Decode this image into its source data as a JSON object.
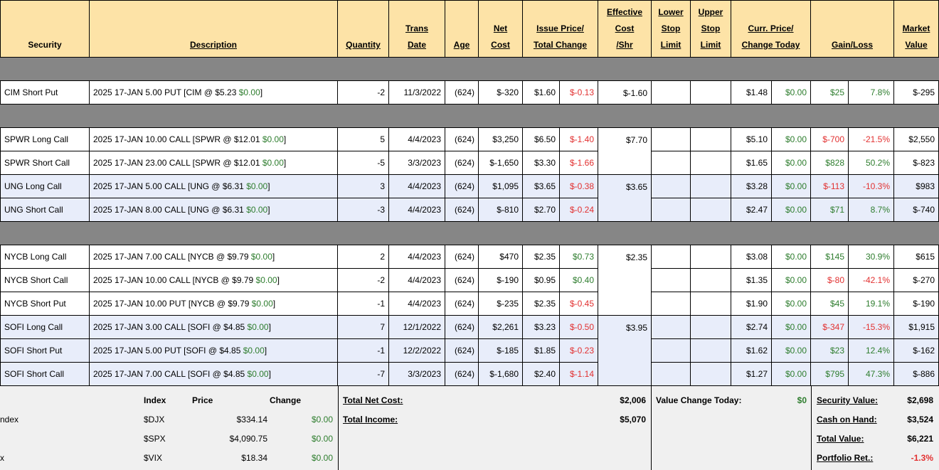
{
  "headers": [
    [
      "Security"
    ],
    [
      "Description"
    ],
    [
      "Quantity"
    ],
    [
      "Trans",
      "Date"
    ],
    [
      "Age"
    ],
    [
      "Net",
      "Cost"
    ],
    [
      "Issue Price/",
      "Total Change"
    ],
    [
      "Effective",
      "Cost",
      "/Shr"
    ],
    [
      "Lower",
      "Stop",
      "Limit"
    ],
    [
      "Upper",
      "Stop",
      "Limit"
    ],
    [
      "Curr. Price/",
      "Change Today"
    ],
    [
      "Gain/Loss"
    ],
    [
      "Market",
      "Value"
    ]
  ],
  "groups": [
    {
      "rows": [
        {
          "security": "CIM Short Put",
          "desc": "2025 17-JAN 5.00 PUT [CIM @ $5.23 ",
          "desc_change": "$0.00",
          "desc_end": "]",
          "qty": "-2",
          "date": "11/3/2022",
          "age": "(624)",
          "net": "$-320",
          "issue": "$1.60",
          "total_change": "$-0.13",
          "tc_sign": "neg",
          "curr": "$1.48",
          "change_today": "$0.00",
          "gain": "$25",
          "gain_pct": "7.8%",
          "gain_sign": "pos",
          "market": "$-295"
        }
      ],
      "eff": [
        {
          "value": "$-1.60",
          "span": 1
        }
      ]
    },
    {
      "rows": [
        {
          "security": "SPWR Long Call",
          "desc": "2025 17-JAN 10.00 CALL [SPWR @ $12.01 ",
          "desc_change": "$0.00",
          "desc_end": "]",
          "qty": "5",
          "date": "4/4/2023",
          "age": "(624)",
          "net": "$3,250",
          "issue": "$6.50",
          "total_change": "$-1.40",
          "tc_sign": "neg",
          "curr": "$5.10",
          "change_today": "$0.00",
          "gain": "$-700",
          "gain_pct": "-21.5%",
          "gain_sign": "neg",
          "market": "$2,550"
        },
        {
          "security": "SPWR Short Call",
          "desc": "2025 17-JAN 23.00 CALL [SPWR @ $12.01 ",
          "desc_change": "$0.00",
          "desc_end": "]",
          "qty": "-5",
          "date": "3/3/2023",
          "age": "(624)",
          "net": "$-1,650",
          "issue": "$3.30",
          "total_change": "$-1.66",
          "tc_sign": "neg",
          "curr": "$1.65",
          "change_today": "$0.00",
          "gain": "$828",
          "gain_pct": "50.2%",
          "gain_sign": "pos",
          "market": "$-823"
        },
        {
          "security": "UNG Long Call",
          "desc": "2025 17-JAN 5.00 CALL [UNG @ $6.31 ",
          "desc_change": "$0.00",
          "desc_end": "]",
          "qty": "3",
          "date": "4/4/2023",
          "age": "(624)",
          "net": "$1,095",
          "issue": "$3.65",
          "total_change": "$-0.38",
          "tc_sign": "neg",
          "curr": "$3.28",
          "change_today": "$0.00",
          "gain": "$-113",
          "gain_pct": "-10.3%",
          "gain_sign": "neg",
          "market": "$983",
          "blue": true
        },
        {
          "security": "UNG Short Call",
          "desc": "2025 17-JAN 8.00 CALL [UNG @ $6.31 ",
          "desc_change": "$0.00",
          "desc_end": "]",
          "qty": "-3",
          "date": "4/4/2023",
          "age": "(624)",
          "net": "$-810",
          "issue": "$2.70",
          "total_change": "$-0.24",
          "tc_sign": "neg",
          "curr": "$2.47",
          "change_today": "$0.00",
          "gain": "$71",
          "gain_pct": "8.7%",
          "gain_sign": "pos",
          "market": "$-740",
          "blue": true
        }
      ],
      "eff": [
        {
          "value": "$7.70",
          "span": 2
        },
        {
          "value": "$3.65",
          "span": 2,
          "blue": true
        }
      ]
    },
    {
      "rows": [
        {
          "security": "NYCB Long Call",
          "desc": "2025 17-JAN 7.00 CALL [NYCB @ $9.79 ",
          "desc_change": "$0.00",
          "desc_end": "]",
          "qty": "2",
          "date": "4/4/2023",
          "age": "(624)",
          "net": "$470",
          "issue": "$2.35",
          "total_change": "$0.73",
          "tc_sign": "pos",
          "curr": "$3.08",
          "change_today": "$0.00",
          "gain": "$145",
          "gain_pct": "30.9%",
          "gain_sign": "pos",
          "market": "$615"
        },
        {
          "security": "NYCB Short Call",
          "desc": "2025 17-JAN 10.00 CALL [NYCB @ $9.79 ",
          "desc_change": "$0.00",
          "desc_end": "]",
          "qty": "-2",
          "date": "4/4/2023",
          "age": "(624)",
          "net": "$-190",
          "issue": "$0.95",
          "total_change": "$0.40",
          "tc_sign": "pos",
          "curr": "$1.35",
          "change_today": "$0.00",
          "gain": "$-80",
          "gain_pct": "-42.1%",
          "gain_sign": "neg",
          "market": "$-270"
        },
        {
          "security": "NYCB Short Put",
          "desc": "2025 17-JAN 10.00 PUT [NYCB @ $9.79 ",
          "desc_change": "$0.00",
          "desc_end": "]",
          "qty": "-1",
          "date": "4/4/2023",
          "age": "(624)",
          "net": "$-235",
          "issue": "$2.35",
          "total_change": "$-0.45",
          "tc_sign": "neg",
          "curr": "$1.90",
          "change_today": "$0.00",
          "gain": "$45",
          "gain_pct": "19.1%",
          "gain_sign": "pos",
          "market": "$-190"
        },
        {
          "security": "SOFI Long Call",
          "desc": "2025 17-JAN 3.00 CALL [SOFI @ $4.85 ",
          "desc_change": "$0.00",
          "desc_end": "]",
          "qty": "7",
          "date": "12/1/2022",
          "age": "(624)",
          "net": "$2,261",
          "issue": "$3.23",
          "total_change": "$-0.50",
          "tc_sign": "neg",
          "curr": "$2.74",
          "change_today": "$0.00",
          "gain": "$-347",
          "gain_pct": "-15.3%",
          "gain_sign": "neg",
          "market": "$1,915",
          "blue": true
        },
        {
          "security": "SOFI Short Put",
          "desc": "2025 17-JAN 5.00 PUT [SOFI @ $4.85 ",
          "desc_change": "$0.00",
          "desc_end": "]",
          "qty": "-1",
          "date": "12/2/2022",
          "age": "(624)",
          "net": "$-185",
          "issue": "$1.85",
          "total_change": "$-0.23",
          "tc_sign": "neg",
          "curr": "$1.62",
          "change_today": "$0.00",
          "gain": "$23",
          "gain_pct": "12.4%",
          "gain_sign": "pos",
          "market": "$-162",
          "blue": true
        },
        {
          "security": "SOFI Short Call",
          "desc": "2025 17-JAN 7.00 CALL [SOFI @ $4.85 ",
          "desc_change": "$0.00",
          "desc_end": "]",
          "qty": "-7",
          "date": "3/3/2023",
          "age": "(624)",
          "net": "$-1,680",
          "issue": "$2.40",
          "total_change": "$-1.14",
          "tc_sign": "neg",
          "curr": "$1.27",
          "change_today": "$0.00",
          "gain": "$795",
          "gain_pct": "47.3%",
          "gain_sign": "pos",
          "market": "$-886",
          "blue": true
        }
      ],
      "eff": [
        {
          "value": "$2.35",
          "span": 3
        },
        {
          "value": "$3.95",
          "span": 3,
          "blue": true
        }
      ]
    }
  ],
  "footer": {
    "index_header": "Index",
    "price_header": "Price",
    "change_header": "Change",
    "indices": [
      {
        "label": "ndex",
        "symbol": "$DJX",
        "price": "$334.14",
        "change": "$0.00"
      },
      {
        "label": "",
        "symbol": "$SPX",
        "price": "$4,090.75",
        "change": "$0.00"
      },
      {
        "label": "x",
        "symbol": "$VIX",
        "price": "$18.34",
        "change": "$0.00"
      }
    ],
    "total_net_cost_label": "Total Net Cost:",
    "total_net_cost": "$2,006",
    "total_income_label": "Total Income:",
    "total_income": "$5,070",
    "value_change_label": "Value Change Today:",
    "value_change": "$0",
    "security_value_label": "Security Value:",
    "security_value": "$2,698",
    "cash_label": "Cash on Hand:",
    "cash": "$3,524",
    "total_value_label": "Total Value:",
    "total_value": "$6,221",
    "portfolio_ret_label": "Portfolio Ret.:",
    "portfolio_ret": "-1.3%"
  },
  "colors": {
    "header_bg": "#fde3a7",
    "separator": "#868686",
    "row_blue": "#e8edfa",
    "negative": "#e23030",
    "positive": "#2e7d2e",
    "footer_bg": "#f0f0f0"
  }
}
